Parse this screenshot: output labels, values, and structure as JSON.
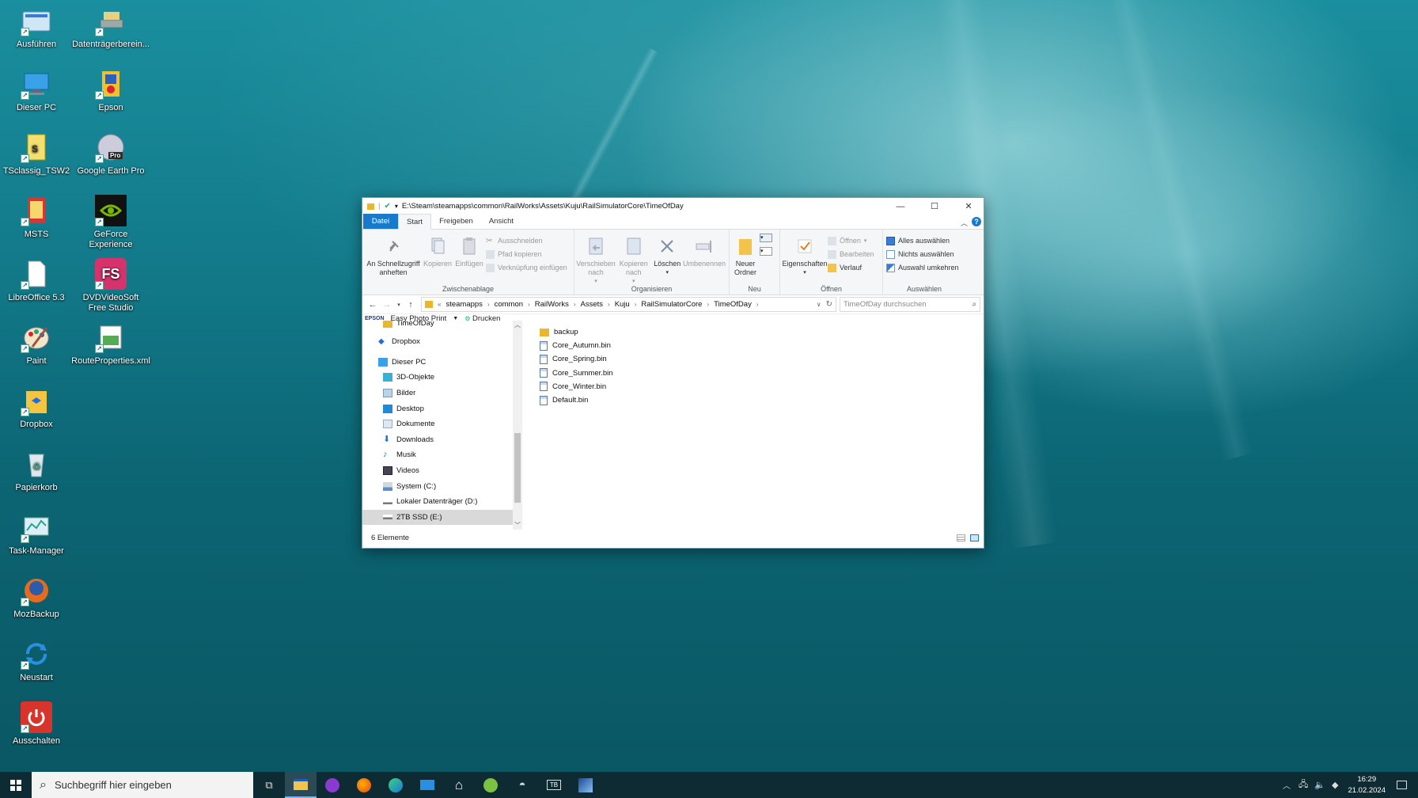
{
  "desktop": {
    "icons": [
      {
        "label": "Ausführen"
      },
      {
        "label": "Datenträgerberein..."
      },
      {
        "label": "Dieser PC"
      },
      {
        "label": "Epson"
      },
      {
        "label": "TSclassig_TSW2"
      },
      {
        "label": "Google Earth Pro"
      },
      {
        "label": "MSTS"
      },
      {
        "label": "GeForce Experience"
      },
      {
        "label": "LibreOffice 5.3"
      },
      {
        "label": "DVDVideoSoft Free Studio"
      },
      {
        "label": "Paint"
      },
      {
        "label": "RouteProperties.xml"
      },
      {
        "label": "Dropbox"
      },
      {
        "label": "Papierkorb"
      },
      {
        "label": "Task-Manager"
      },
      {
        "label": "MozBackup"
      },
      {
        "label": "Neustart"
      },
      {
        "label": "Ausschalten"
      }
    ]
  },
  "window": {
    "title": "E:\\Steam\\steamapps\\common\\RailWorks\\Assets\\Kuju\\RailSimulatorCore\\TimeOfDay",
    "tabs": {
      "file": "Datei",
      "start": "Start",
      "share": "Freigeben",
      "view": "Ansicht"
    },
    "ribbon": {
      "clipboard": {
        "pin": "An Schnellzugriff anheften",
        "copy": "Kopieren",
        "paste": "Einfügen",
        "cut": "Ausschneiden",
        "copy_path": "Pfad kopieren",
        "paste_link": "Verknüpfung einfügen",
        "label": "Zwischenablage"
      },
      "organize": {
        "move": "Verschieben nach",
        "copy_to": "Kopieren nach",
        "delete": "Löschen",
        "rename": "Umbenennen",
        "label": "Organisieren"
      },
      "new": {
        "new_folder": "Neuer Ordner",
        "label": "Neu"
      },
      "open": {
        "properties": "Eigenschaften",
        "open": "Öffnen",
        "edit": "Bearbeiten",
        "history": "Verlauf",
        "label": "Öffnen"
      },
      "select": {
        "all": "Alles auswählen",
        "none": "Nichts auswählen",
        "invert": "Auswahl umkehren",
        "label": "Auswählen"
      }
    },
    "path": [
      "steamapps",
      "common",
      "RailWorks",
      "Assets",
      "Kuju",
      "RailSimulatorCore",
      "TimeOfDay"
    ],
    "search_placeholder": "TimeOfDay durchsuchen",
    "favbar": {
      "brand": "EPSON",
      "app": "Easy Photo Print",
      "print": "Drucken"
    },
    "nav": [
      "TimeOfDay",
      "Dropbox",
      "Dieser PC",
      "3D-Objekte",
      "Bilder",
      "Desktop",
      "Dokumente",
      "Downloads",
      "Musik",
      "Videos",
      "System (C:)",
      "Lokaler Datenträger (D:)",
      "2TB SSD (E:)"
    ],
    "files": [
      "backup",
      "Core_Autumn.bin",
      "Core_Spring.bin",
      "Core_Summer.bin",
      "Core_Winter.bin",
      "Default.bin"
    ],
    "status": "6 Elemente"
  },
  "taskbar": {
    "search_placeholder": "Suchbegriff hier eingeben",
    "time": "16:29",
    "date": "21.02.2024"
  }
}
